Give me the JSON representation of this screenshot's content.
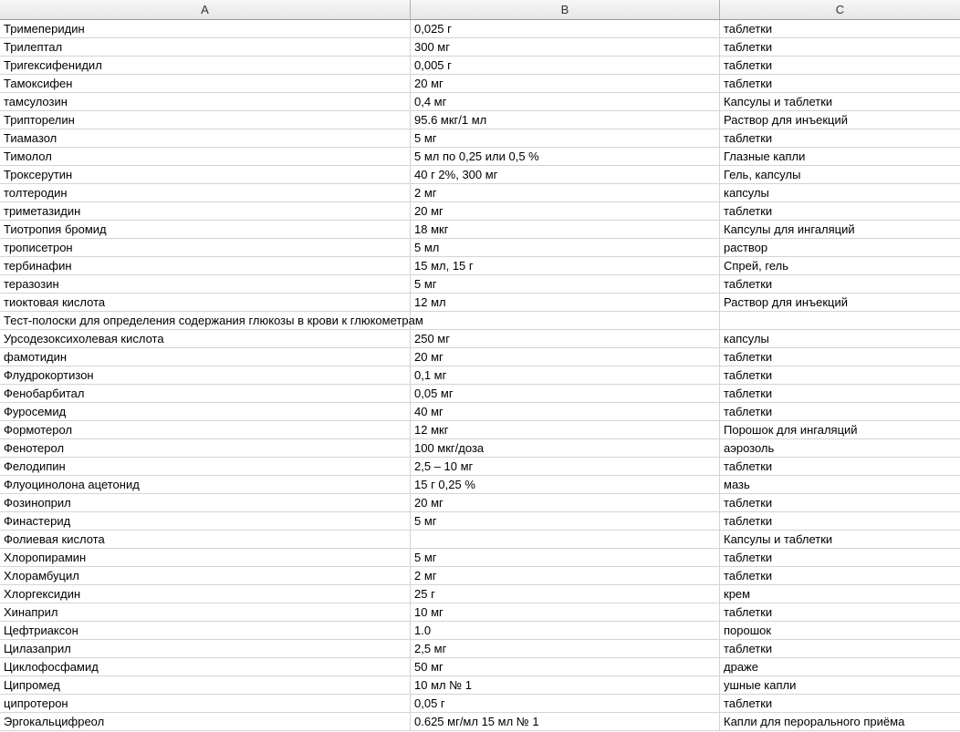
{
  "columns": [
    "A",
    "B",
    "C"
  ],
  "rows": [
    [
      "Тримеперидин",
      " 0,025 г",
      "таблетки"
    ],
    [
      "Трилептал",
      "300 мг",
      "таблетки"
    ],
    [
      "Тригексифенидил",
      "0,005 г",
      "таблетки"
    ],
    [
      "Тамоксифен",
      "20 мг",
      "таблетки"
    ],
    [
      "тамсулозин",
      "0,4 мг",
      "Капсулы и таблетки"
    ],
    [
      "Трипторелин",
      "95.6 мкг/1 мл",
      "Раствор для инъекций"
    ],
    [
      "Тиамазол",
      "5 мг",
      "таблетки"
    ],
    [
      "Тимолол",
      "5 мл по 0,25 или 0,5 %",
      "Глазные капли"
    ],
    [
      "Троксерутин",
      "40 г 2%, 300 мг",
      "Гель, капсулы"
    ],
    [
      "толтеродин",
      "2 мг",
      "капсулы"
    ],
    [
      "триметазидин",
      "20 мг",
      "таблетки"
    ],
    [
      "Тиотропия бромид",
      "18 мкг",
      "Капсулы для ингаляций"
    ],
    [
      "трописетрон",
      "5 мл",
      "раствор"
    ],
    [
      "тербинафин",
      "15 мл, 15 г",
      "Спрей, гель"
    ],
    [
      "теразозин",
      "5 мг",
      "таблетки"
    ],
    [
      "тиоктовая кислота",
      "12 мл",
      "Раствор для инъекций"
    ],
    [
      "Тест-полоски для определения содержания глюкозы в крови к глюкометрам",
      "",
      ""
    ],
    [
      "Урсодезоксихолевая кислота",
      "250 мг",
      "капсулы"
    ],
    [
      "фамотидин",
      "20 мг",
      "таблетки"
    ],
    [
      "Флудрокортизон",
      "0,1 мг",
      "таблетки"
    ],
    [
      "Фенобарбитал",
      "0,05 мг",
      "таблетки"
    ],
    [
      "Фуросемид",
      "40 мг",
      "таблетки"
    ],
    [
      "Формотерол",
      "12 мкг",
      "Порошок для ингаляций"
    ],
    [
      "Фенотерол",
      "100 мкг/доза",
      "аэрозоль"
    ],
    [
      "Фелодипин",
      "2,5 – 10 мг",
      "таблетки"
    ],
    [
      "Флуоцинолона ацетонид",
      "15 г 0,25 %",
      "мазь"
    ],
    [
      "Фозиноприл",
      "20 мг",
      "таблетки"
    ],
    [
      "Финастерид",
      "5 мг",
      "таблетки"
    ],
    [
      "Фолиевая кислота",
      "",
      "Капсулы и таблетки"
    ],
    [
      "Хлоропирамин",
      "5 мг",
      "таблетки"
    ],
    [
      "Хлорамбуцил",
      "2 мг",
      "таблетки"
    ],
    [
      "Хлоргексидин",
      "25 г",
      "крем"
    ],
    [
      "Хинаприл",
      "10 мг",
      "таблетки"
    ],
    [
      "Цефтриаксон",
      "1.0",
      "порошок"
    ],
    [
      "Цилазаприл",
      "2,5 мг",
      "таблетки"
    ],
    [
      "Циклофосфамид",
      "50 мг",
      "драже"
    ],
    [
      "Ципромед",
      "10 мл № 1",
      "ушные капли"
    ],
    [
      "ципротерон",
      "0,05 г",
      "таблетки"
    ],
    [
      "Эргокальцифреол",
      "0.625 мг/мл 15 мл № 1",
      "Капли для перорального приёма"
    ]
  ]
}
